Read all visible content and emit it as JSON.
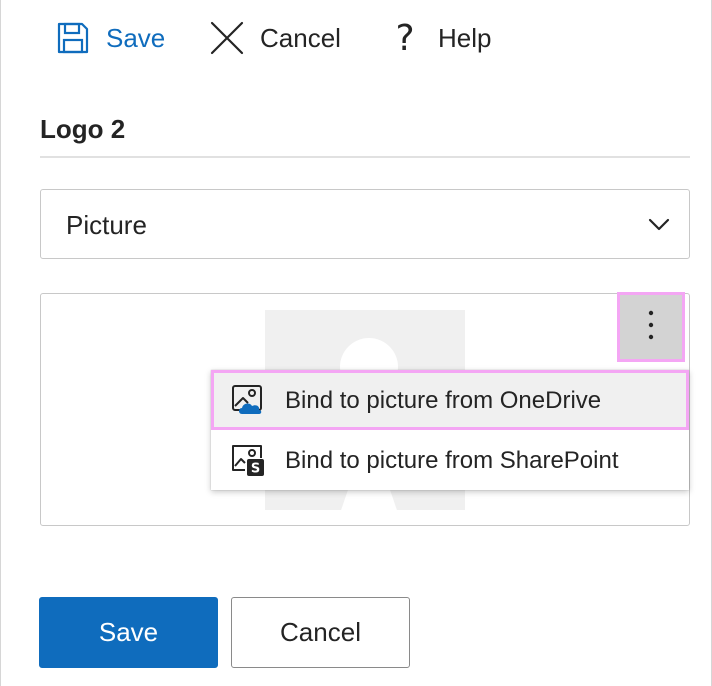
{
  "toolbar": {
    "save_label": "Save",
    "cancel_label": "Cancel",
    "help_icon_glyph": "?",
    "help_label": "Help"
  },
  "form": {
    "name_value": "Logo 2",
    "type_value": "Picture"
  },
  "picture_menu": {
    "more_icon": "more-vertical-icon",
    "items": [
      {
        "label": "Bind to picture from OneDrive",
        "icon": "onedrive-picture-icon"
      },
      {
        "label": "Bind to picture from SharePoint",
        "icon": "sharepoint-picture-icon"
      }
    ]
  },
  "footer": {
    "save_label": "Save",
    "cancel_label": "Cancel"
  },
  "colors": {
    "accent": "#0f6cbd",
    "highlight": "#f4a6f4"
  }
}
